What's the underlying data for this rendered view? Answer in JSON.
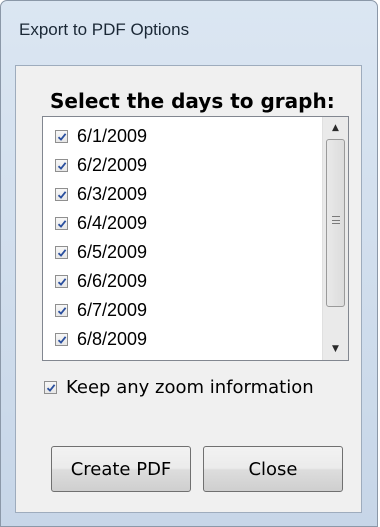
{
  "window": {
    "title": "Export to PDF Options"
  },
  "dialog": {
    "heading": "Select the days to graph:",
    "days": [
      {
        "label": "6/1/2009",
        "checked": true
      },
      {
        "label": "6/2/2009",
        "checked": true
      },
      {
        "label": "6/3/2009",
        "checked": true
      },
      {
        "label": "6/4/2009",
        "checked": true
      },
      {
        "label": "6/5/2009",
        "checked": true
      },
      {
        "label": "6/6/2009",
        "checked": true
      },
      {
        "label": "6/7/2009",
        "checked": true
      },
      {
        "label": "6/8/2009",
        "checked": true
      }
    ],
    "keep_zoom": {
      "label": "Keep any zoom information",
      "checked": true
    },
    "buttons": {
      "create": "Create PDF",
      "close": "Close"
    }
  },
  "colors": {
    "window_frame": "#c7d6e8",
    "client_bg": "#f0f0f0",
    "check": "#2a4f9e"
  },
  "icons": {
    "checkbox_mark": "checkmark-icon",
    "scroll_up": "up-arrow-icon",
    "scroll_down": "down-arrow-icon",
    "scroll_grip": "grip-icon"
  }
}
